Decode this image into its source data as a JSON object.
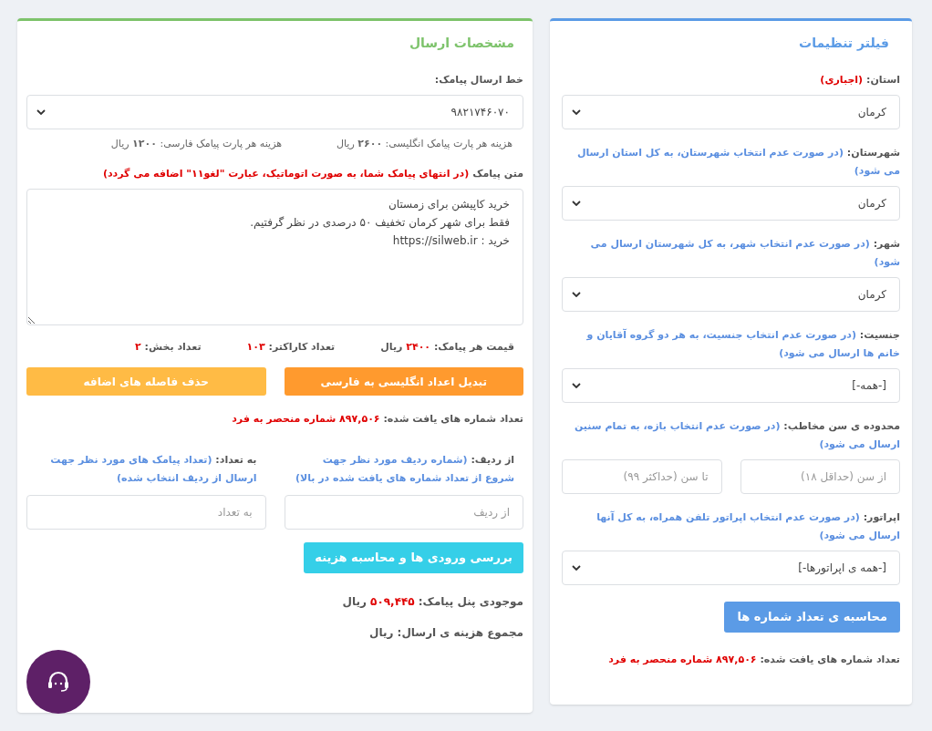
{
  "filter_card": {
    "title": "فیلتر تنظیمات",
    "fields": [
      {
        "kind": "select",
        "label": "استان:",
        "note": {
          "text": "(اجباری)",
          "kind": "required"
        },
        "value": "کرمان"
      },
      {
        "kind": "select",
        "label": "شهرستان:",
        "note": {
          "text": "(در صورت عدم انتخاب شهرستان، به کل استان ارسال می شود)",
          "kind": "hint"
        },
        "value": "کرمان"
      },
      {
        "kind": "select",
        "label": "شهر:",
        "note": {
          "text": "(در صورت عدم انتخاب شهر، به کل شهرستان ارسال می شود)",
          "kind": "hint"
        },
        "value": "کرمان"
      },
      {
        "kind": "select",
        "label": "جنسیت:",
        "note": {
          "text": "(در صورت عدم انتخاب جنسیت، به هر دو گروه آقایان و خانم ها ارسال می شود)",
          "kind": "hint"
        },
        "value": "[-همه-]"
      },
      {
        "kind": "range",
        "label": "محدوده ی سن مخاطب:",
        "note": {
          "text": "(در صورت عدم انتخاب بازه، به تمام سنین ارسال می شود)",
          "kind": "hint"
        },
        "inputs": [
          {
            "placeholder": "از سن (حداقل ۱۸)"
          },
          {
            "placeholder": "تا سن (حداکثر ۹۹)"
          }
        ]
      },
      {
        "kind": "select",
        "label": "اپراتور:",
        "note": {
          "text": "(در صورت عدم انتخاب اپراتور تلفن همراه، به کل آنها ارسال می شود)",
          "kind": "hint"
        },
        "value": "[-همه ی اپراتورها-]"
      }
    ],
    "button": "محاسبه ی تعداد شماره ها",
    "result": {
      "label": "تعداد شماره های یافت شده:",
      "value": "۸۹۷,۵۰۶ شماره منحصر به فرد"
    }
  },
  "send_card": {
    "title": "مشخصات ارسال",
    "line": {
      "label": "خط ارسال پیامک:",
      "value": "۹۸۲۱۷۴۶۰۷۰"
    },
    "costs": [
      {
        "label": "هزینه هر پارت پیامک انگلیسی:",
        "value": "۲۶۰۰",
        "unit": "ریال"
      },
      {
        "label": "هزینه هر پارت پیامک فارسی:",
        "value": "۱۲۰۰",
        "unit": "ریال"
      }
    ],
    "message": {
      "label": "متن پیامک",
      "note": {
        "text": "(در انتهای پیامک شما، به صورت اتوماتیک، عبارت \"لغو۱۱\" اضافه می گردد)",
        "kind": "required"
      },
      "value": "خرید کاپیشن برای زمستان\nفقط برای شهر کرمان تخفیف ۵۰ درصدی در نظر گرفتیم.\nخرید : https://silweb.ir"
    },
    "stats": [
      {
        "label": "قیمت هر پیامک:",
        "value": "۲۴۰۰",
        "unit": "ریال"
      },
      {
        "label": "تعداد کاراکتر:",
        "value": "۱۰۳"
      },
      {
        "label": "تعداد بخش:",
        "value": "۲"
      }
    ],
    "buttons": [
      {
        "label": "تبدیل اعداد انگلیسی به فارسی",
        "color": "#ff9a2e"
      },
      {
        "label": "حذف فاصله های اضافه",
        "color": "#ffbb45"
      }
    ],
    "result": {
      "label": "تعداد شماره های یافت شده:",
      "value": "۸۹۷,۵۰۶ شماره منحصر به فرد"
    },
    "ranges": [
      {
        "label": "از ردیف:",
        "note": {
          "text": "(شماره ردیف مورد نظر جهت شروع از تعداد شماره های یافت شده در بالا)",
          "kind": "hint"
        },
        "placeholder": "از ردیف"
      },
      {
        "label": "به تعداد:",
        "note": {
          "text": "(تعداد پیامک های مورد نظر جهت ارسال از ردیف انتخاب شده)",
          "kind": "hint"
        },
        "placeholder": "به تعداد"
      }
    ],
    "button": "بررسی ورودی ها و محاسبه هزینه",
    "balance": {
      "label": "موجودی پنل پیامک:",
      "value": "۵۰۹,۴۴۵",
      "unit": "ریال"
    },
    "total": {
      "label": "مجموع هزینه ی ارسال:",
      "unit": "ریال"
    }
  }
}
